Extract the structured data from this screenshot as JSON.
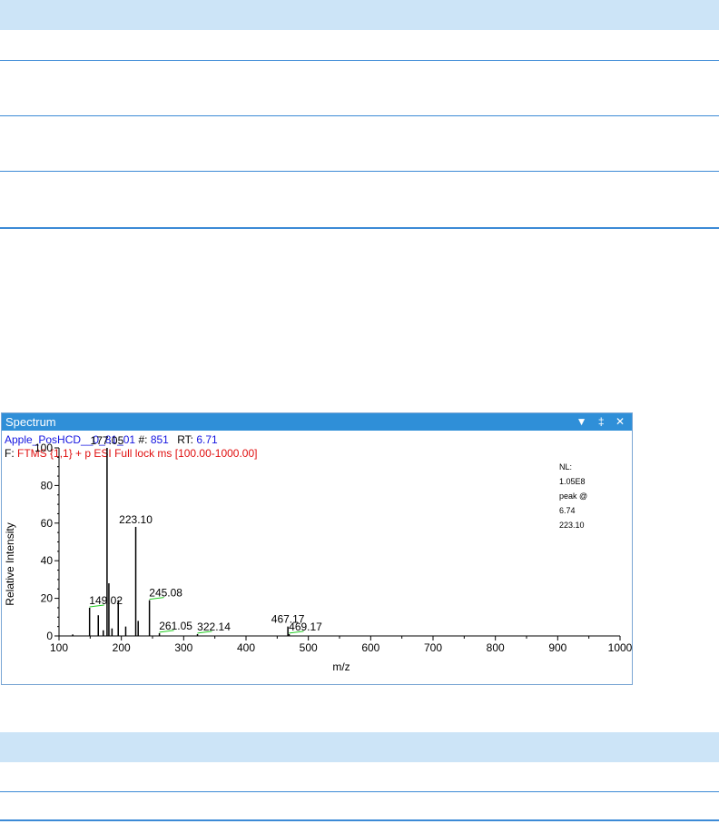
{
  "panel": {
    "title": "Spectrum",
    "header": {
      "file_name": "Apple_PosHCD__0_81_01",
      "scan_label": "#:",
      "scan_number": "851",
      "rt_label": "RT:",
      "rt_value": "6.71",
      "filter_label": "F:",
      "filter_text": "FTMS {1,1}  + p ESI Full lock ms [100.00-1000.00]"
    },
    "nl_annotation": [
      "NL:",
      "1.05E8",
      "peak @",
      "6.74",
      "223.10"
    ]
  },
  "chart_data": {
    "type": "bar",
    "title": "",
    "xlabel": "m/z",
    "ylabel": "Relative Intensity",
    "xlim": [
      100,
      1000
    ],
    "ylim": [
      0,
      100
    ],
    "xticks": [
      100,
      200,
      300,
      400,
      500,
      600,
      700,
      800,
      900,
      1000
    ],
    "yticks": [
      0,
      20,
      40,
      60,
      80,
      100
    ],
    "peaks": [
      {
        "mz": 122.0,
        "intensity": 0.8
      },
      {
        "mz": 149.02,
        "intensity": 15
      },
      {
        "mz": 163.0,
        "intensity": 11
      },
      {
        "mz": 171.0,
        "intensity": 3
      },
      {
        "mz": 177.05,
        "intensity": 100
      },
      {
        "mz": 180.0,
        "intensity": 28
      },
      {
        "mz": 185.0,
        "intensity": 4
      },
      {
        "mz": 195.0,
        "intensity": 19
      },
      {
        "mz": 207.0,
        "intensity": 5
      },
      {
        "mz": 223.1,
        "intensity": 58
      },
      {
        "mz": 227.0,
        "intensity": 8
      },
      {
        "mz": 245.08,
        "intensity": 19
      },
      {
        "mz": 261.05,
        "intensity": 1.5
      },
      {
        "mz": 322.14,
        "intensity": 1
      },
      {
        "mz": 467.17,
        "intensity": 5
      },
      {
        "mz": 469.17,
        "intensity": 1
      }
    ],
    "labels": [
      {
        "text": "177.05",
        "mz": 177.05,
        "intensity": 100
      },
      {
        "text": "223.10",
        "mz": 223.1,
        "intensity": 58
      },
      {
        "text": "149.02",
        "mz": 149.02,
        "intensity": 15
      },
      {
        "text": "245.08",
        "mz": 245.08,
        "intensity": 19
      },
      {
        "text": "261.05",
        "mz": 261.05,
        "intensity": 1.5
      },
      {
        "text": "322.14",
        "mz": 322.14,
        "intensity": 1
      },
      {
        "text": "467.17",
        "mz": 467.17,
        "intensity": 5
      },
      {
        "text": "469.17",
        "mz": 469.17,
        "intensity": 1
      }
    ],
    "line_color": "#000000",
    "leader_color": "#22cc22"
  },
  "colors": {
    "table_header": "#cce4f7",
    "table_rule": "#3c8ad6",
    "titlebar": "#2f8fd8"
  }
}
